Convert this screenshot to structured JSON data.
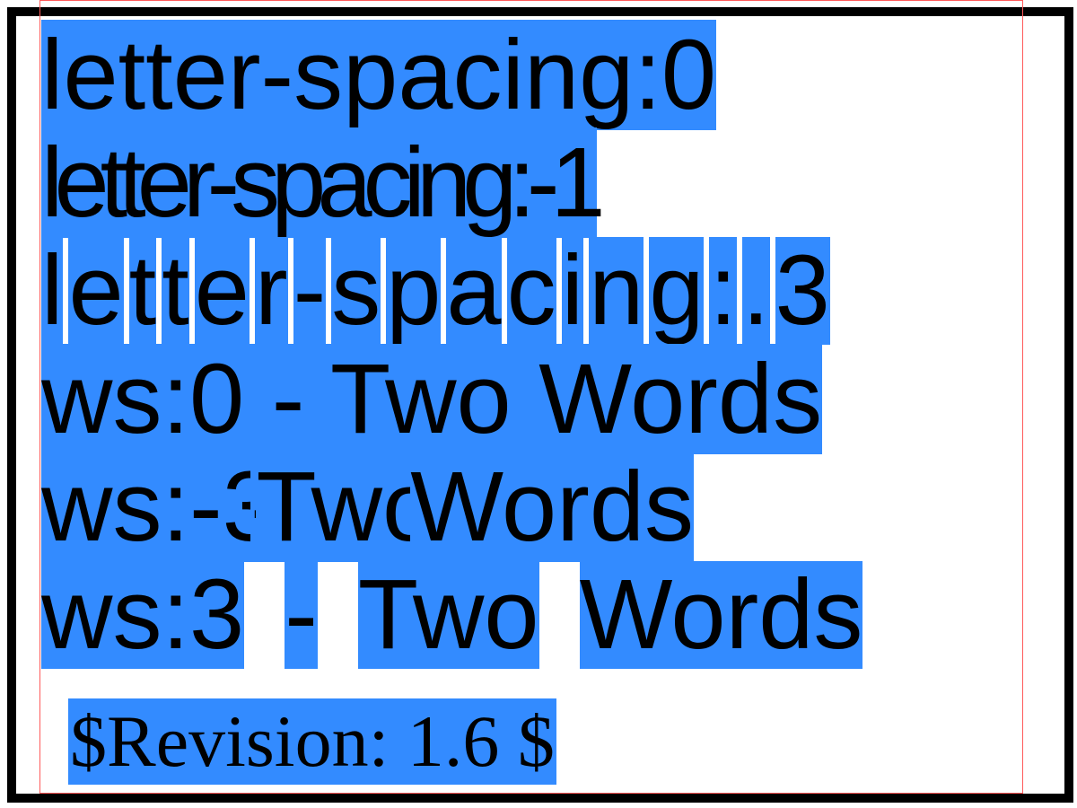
{
  "lines": {
    "ls0": "letter-spacing:0",
    "ls_neg1": "letter-spacing:-1",
    "ls_pos3_chars": [
      "l",
      "e",
      "t",
      "t",
      "e",
      "r",
      "-",
      "s",
      "p",
      "a",
      "c",
      "i",
      "n",
      "g",
      ":",
      ".",
      "3"
    ],
    "ws0": "ws:0 - Two Words",
    "ws_neg3_words": [
      "ws:-3",
      "-",
      "Two",
      "Words"
    ],
    "ws3_words": [
      "ws:3",
      "-",
      "Two",
      "Words"
    ]
  },
  "revision": "$Revision: 1.6 $",
  "colors": {
    "highlight": "#338bff",
    "border": "#000000",
    "outline": "#ff5a5a"
  }
}
